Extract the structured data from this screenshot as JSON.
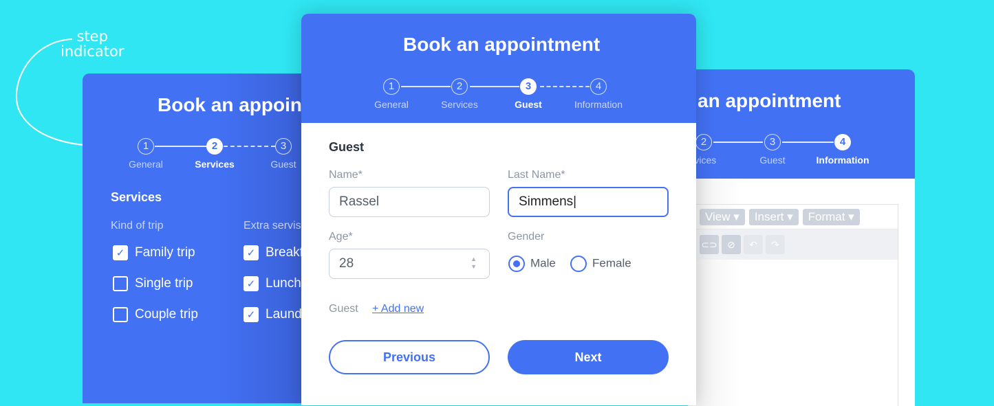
{
  "annotation": {
    "text_line1": "step",
    "text_line2": "indicator"
  },
  "title": "Book an appointment",
  "steps": [
    "General",
    "Services",
    "Guest",
    "Information"
  ],
  "step_numbers": [
    "1",
    "2",
    "3",
    "4"
  ],
  "left": {
    "section": "Services",
    "col1_label": "Kind of trip",
    "col2_label": "Extra servis",
    "trips": [
      {
        "label": "Family trip",
        "checked": true
      },
      {
        "label": "Single trip",
        "checked": false
      },
      {
        "label": "Couple trip",
        "checked": false
      }
    ],
    "extras": [
      {
        "label": "Breakf",
        "checked": true
      },
      {
        "label": "Lunch",
        "checked": true
      },
      {
        "label": "Laund",
        "checked": true
      }
    ]
  },
  "center": {
    "section": "Guest",
    "name_label": "Name*",
    "name_value": "Rassel",
    "last_label": "Last Name*",
    "last_value": "Simmens|",
    "age_label": "Age*",
    "age_value": "28",
    "gender_label": "Gender",
    "gender_options": [
      "Male",
      "Female"
    ],
    "gender_selected": "Male",
    "guest_label": "Guest",
    "add_new": "+ Add new",
    "previous": "Previous",
    "next": "Next"
  },
  "right": {
    "title_partial": "an appointment",
    "step_partial": "rvices",
    "menus": [
      "View",
      "Insert",
      "Format"
    ]
  },
  "colors": {
    "background": "#2fe6f2",
    "primary": "#4271f3"
  }
}
